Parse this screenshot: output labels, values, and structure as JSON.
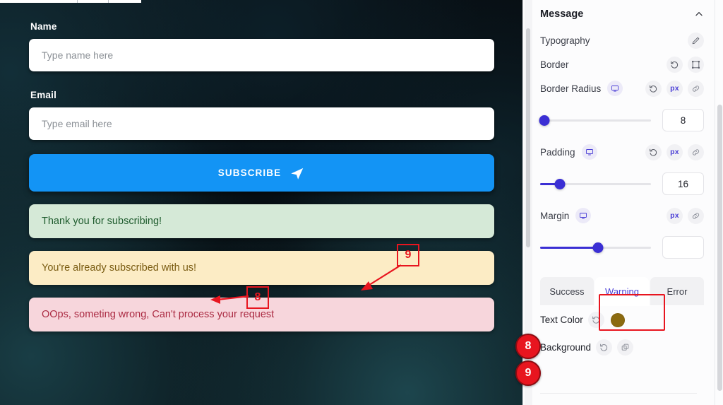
{
  "preview": {
    "name_label": "Name",
    "name_placeholder": "Type name here",
    "email_label": "Email",
    "email_placeholder": "Type email here",
    "subscribe_label": "SUBSCRIBE",
    "messages": [
      {
        "type": "success",
        "text": "Thank you for subscribing!",
        "bg": "#d5e9d7",
        "color": "#1f5c2e"
      },
      {
        "type": "warning",
        "text": "You're already subscribed with us!",
        "bg": "#fcecc5",
        "color": "#7a5c12"
      },
      {
        "type": "error",
        "text": "OOps, someting wrong, Can't process your request",
        "bg": "#f7d6dc",
        "color": "#ab2a42"
      }
    ],
    "button_color": "#1394f5"
  },
  "panel": {
    "section_title": "Message",
    "collapse_icon": "chevron-up-icon",
    "rows": {
      "typography": {
        "label": "Typography",
        "edit_icon": "pencil-icon"
      },
      "border": {
        "label": "Border",
        "reset_icon": "reset-icon",
        "box_icon": "border-box-icon"
      },
      "border_radius": {
        "label": "Border Radius",
        "device_icon": "desktop-icon",
        "reset_icon": "reset-icon",
        "unit": "px",
        "link_icon": "link-icon",
        "value": "8",
        "slider_percent": 4
      },
      "padding": {
        "label": "Padding",
        "device_icon": "desktop-icon",
        "reset_icon": "reset-icon",
        "unit": "px",
        "link_icon": "link-icon",
        "value": "16",
        "slider_percent": 18
      },
      "margin": {
        "label": "Margin",
        "device_icon": "desktop-icon",
        "unit": "px",
        "link_icon": "link-icon",
        "value": "",
        "slider_percent": 52
      }
    },
    "tabs": [
      {
        "label": "Success",
        "active": false
      },
      {
        "label": "Warning",
        "active": true
      },
      {
        "label": "Error",
        "active": false
      }
    ],
    "color_rows": [
      {
        "label": "Text Color",
        "reset_icon": "reset-icon",
        "swatch": "#8b6a10",
        "control": "swatch"
      },
      {
        "label": "Background",
        "reset_icon": "reset-icon",
        "control": "copy-icon"
      }
    ],
    "accent": "#4b3fd6"
  },
  "annotations": {
    "badge_8": "8",
    "badge_9": "9",
    "callout_8": "8",
    "callout_9": "9",
    "highlight_target": "Warning",
    "color": "#e8151f"
  }
}
